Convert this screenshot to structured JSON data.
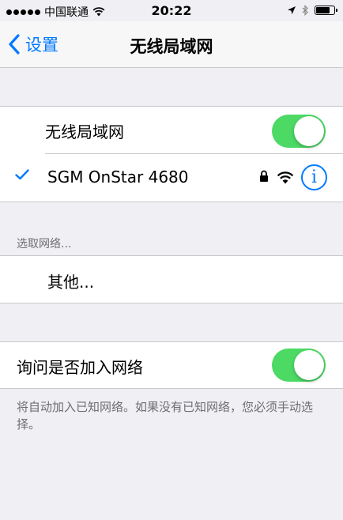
{
  "status_bar": {
    "carrier": "中国联通",
    "time": "20:22"
  },
  "nav": {
    "back_label": "设置",
    "title": "无线局域网"
  },
  "wifi_group": {
    "toggle_label": "无线局域网",
    "toggle_on": true,
    "connected_network": "SGM OnStar 4680"
  },
  "choose_network": {
    "header": "选取网络...",
    "other_label": "其他..."
  },
  "ask_group": {
    "label": "询问是否加入网络",
    "toggle_on": true,
    "footer": "将自动加入已知网络。如果没有已知网络，您必须手动选择。"
  },
  "colors": {
    "accent": "#007aff",
    "toggle_on": "#4cd964",
    "background": "#efeff4"
  }
}
